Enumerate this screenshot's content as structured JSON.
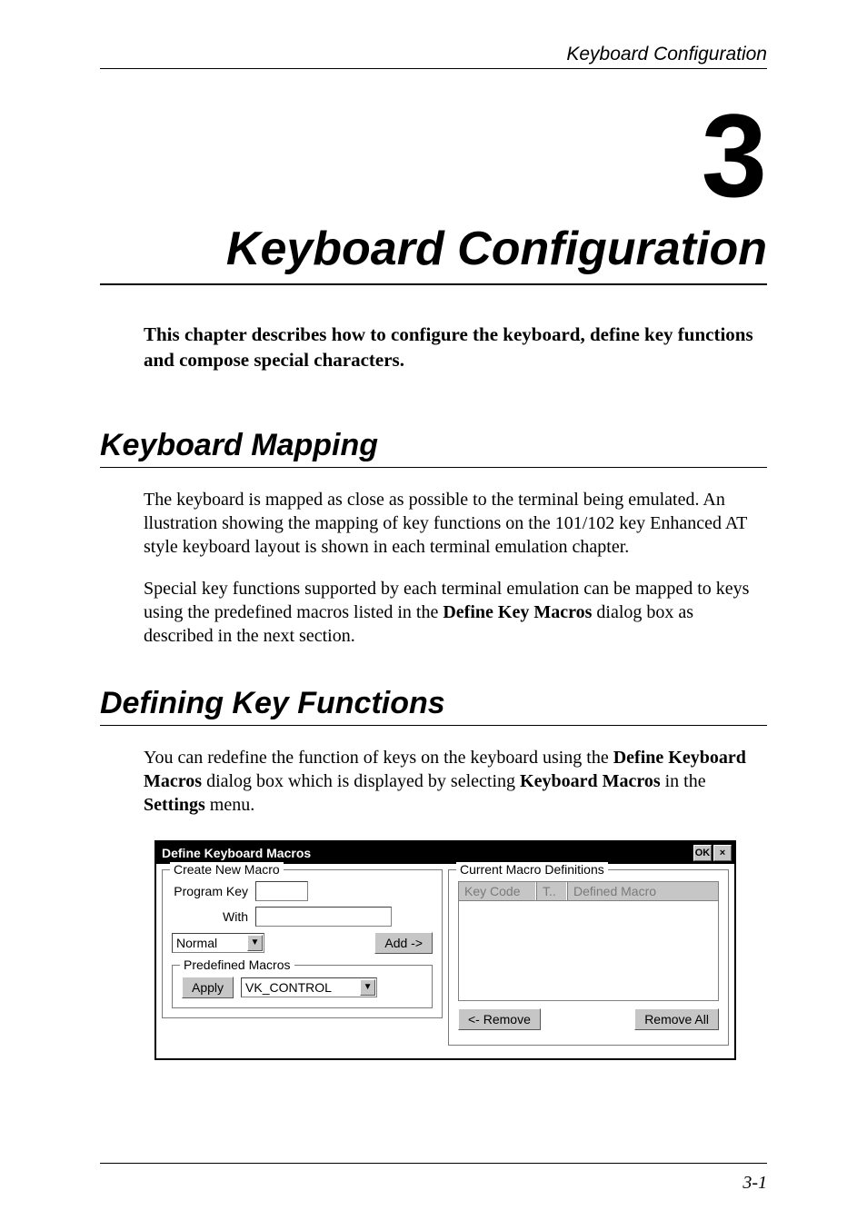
{
  "header": {
    "running": "Keyboard Configuration"
  },
  "chapter": {
    "number": "3",
    "title": "Keyboard Configuration",
    "intro": "This chapter describes how to configure the keyboard, define key functions and compose special characters."
  },
  "sections": {
    "mapping": {
      "heading": "Keyboard Mapping",
      "p1": "The keyboard is mapped as close as possible to the terminal being emulated. An llustration showing the mapping of key functions on the 101/102 key Enhanced AT style keyboard layout is shown in each terminal emulation chapter.",
      "p2a": "Special key functions supported by each terminal emulation can be mapped to keys using the predefined macros listed in the ",
      "p2_bold": "Define Key Macros",
      "p2b": " dialog box as described in the next section."
    },
    "defining": {
      "heading": "Defining Key Functions",
      "p1a": "You can redefine the function of keys on the keyboard using the ",
      "p1_bold1": "Define Keyboard Macros",
      "p1b": " dialog box which is displayed by selecting ",
      "p1_bold2": "Keyboard Macros",
      "p1c": " in the ",
      "p1_bold3": "Settings",
      "p1d": " menu."
    }
  },
  "dialog": {
    "title": "Define Keyboard Macros",
    "ok_label": "OK",
    "close_label": "×",
    "group_create": "Create New Macro",
    "program_key_label": "Program Key",
    "with_label": "With",
    "mode_value": "Normal",
    "add_label": "Add ->",
    "group_predef": "Predefined Macros",
    "apply_label": "Apply",
    "predef_value": "VK_CONTROL",
    "group_current": "Current Macro Definitions",
    "col1": "Key Code",
    "col2": "T..",
    "col3": "Defined Macro",
    "remove_label": "<- Remove",
    "remove_all_label": "Remove All"
  },
  "footer": {
    "page": "3-1"
  }
}
